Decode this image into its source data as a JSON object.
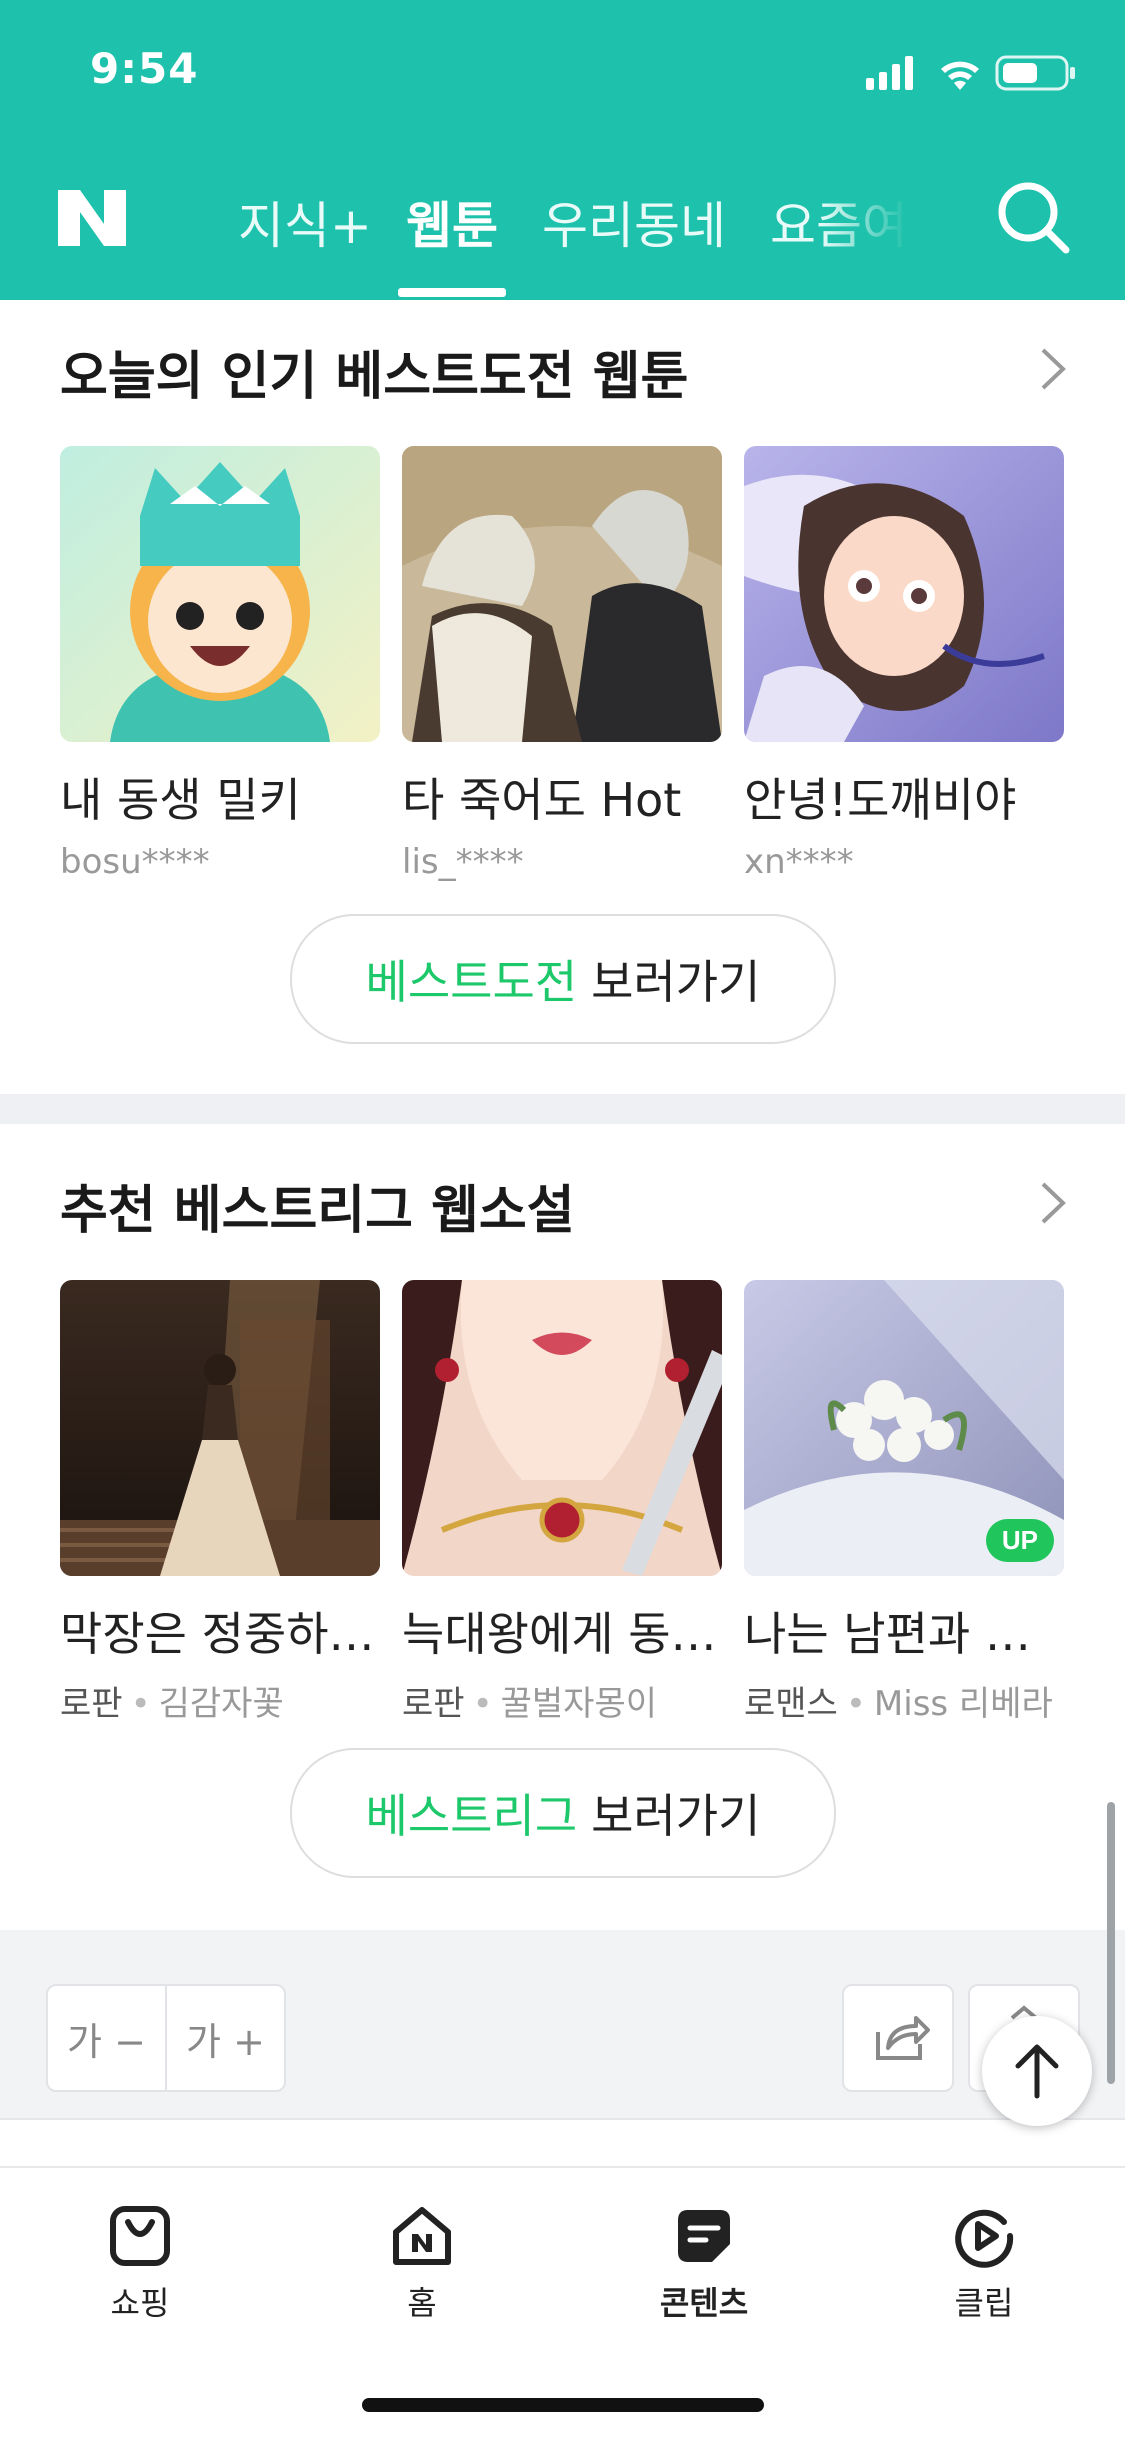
{
  "status_bar": {
    "time": "9:54"
  },
  "header": {
    "logo": "N",
    "tabs": [
      {
        "label": "지식+"
      },
      {
        "label": "웹툰"
      },
      {
        "label": "우리동네"
      },
      {
        "label": "요즘여"
      }
    ],
    "active_tab": "웹툰"
  },
  "webtoon_section": {
    "title": "오늘의 인기 베스트도전 웹툰",
    "items": [
      {
        "title": "내 동생 밀키",
        "author": "bosu****"
      },
      {
        "title": "타 죽어도 Hot",
        "author": "lis_****"
      },
      {
        "title": "안녕!도깨비야",
        "author": "xn****"
      }
    ],
    "button_highlight": "베스트도전",
    "button_rest": "보러가기"
  },
  "novel_section": {
    "title": "추천 베스트리그 웹소설",
    "items": [
      {
        "title": "막장은 정중하게...",
        "genre": "로판",
        "author": "김감자꽃"
      },
      {
        "title": "늑대왕에게 동생...",
        "genre": "로판",
        "author": "꿀벌자몽이"
      },
      {
        "title": "나는 남편과 아...",
        "genre": "로맨스",
        "author": "Miss 리베라",
        "badge": "UP"
      }
    ],
    "button_highlight": "베스트리그",
    "button_rest": "보러가기"
  },
  "tools": {
    "font_decrease": "가 −",
    "font_increase": "가 +"
  },
  "bottom_nav": [
    {
      "label": "쇼핑",
      "icon": "shopping-bag-icon"
    },
    {
      "label": "홈",
      "icon": "home-icon"
    },
    {
      "label": "콘텐츠",
      "icon": "contents-icon",
      "active": true
    },
    {
      "label": "클립",
      "icon": "clip-icon"
    }
  ],
  "colors": {
    "brand": "#1ec1ab",
    "accent_green": "#1dc86a",
    "badge_green": "#20c55b"
  }
}
